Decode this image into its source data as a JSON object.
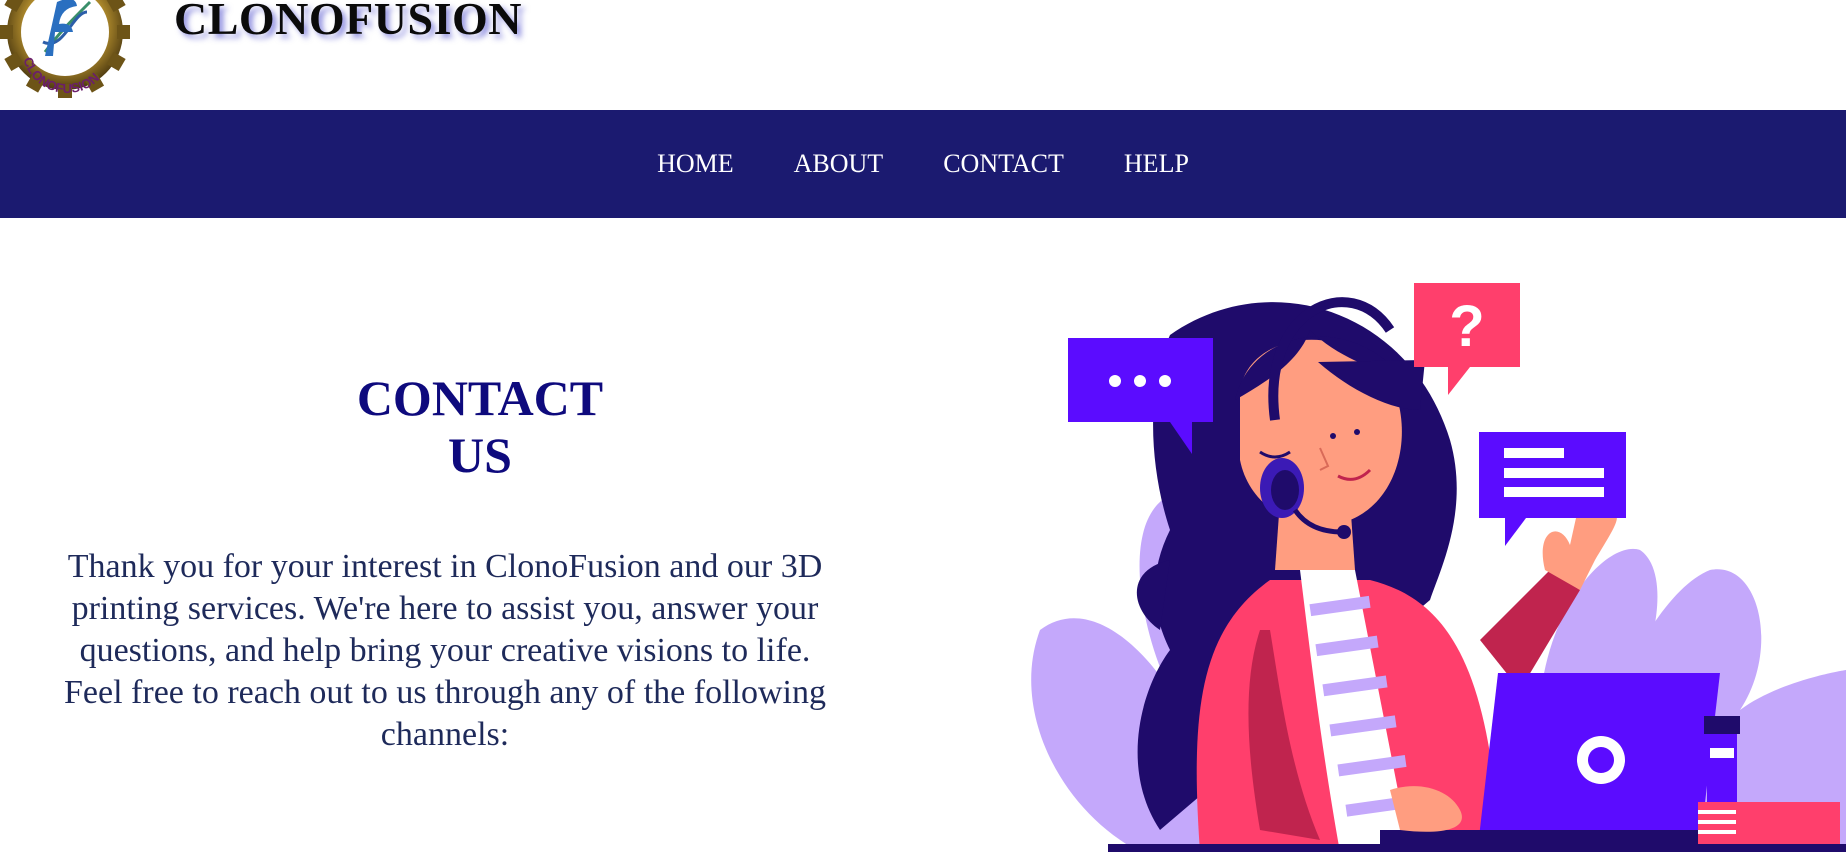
{
  "header": {
    "brand_name": "CLONOFUSION",
    "logo_text": "CLONOFUSION"
  },
  "nav": {
    "items": [
      {
        "label": "HOME"
      },
      {
        "label": "ABOUT"
      },
      {
        "label": "CONTACT"
      },
      {
        "label": "HELP"
      }
    ]
  },
  "main": {
    "title_line1": "CONTACT",
    "title_line2": "US",
    "intro": "Thank you for your interest in ClonoFusion and our 3D printing services. We're here to assist you, answer your questions, and help bring your creative visions to life. Feel free to reach out to us through any of the following channels:"
  },
  "colors": {
    "nav_bg": "#1b1a70",
    "title": "#0e0a7d",
    "intro_text": "#1e2a5a",
    "accent_purple": "#5b0cff",
    "accent_pink": "#ff3f6c",
    "leaf_lavender": "#c4a8fb"
  },
  "icons": {
    "logo": "gear-dna-logo-icon",
    "chat_typing": "chat-dots-icon",
    "chat_question": "question-bubble-icon",
    "chat_text": "message-lines-icon"
  }
}
